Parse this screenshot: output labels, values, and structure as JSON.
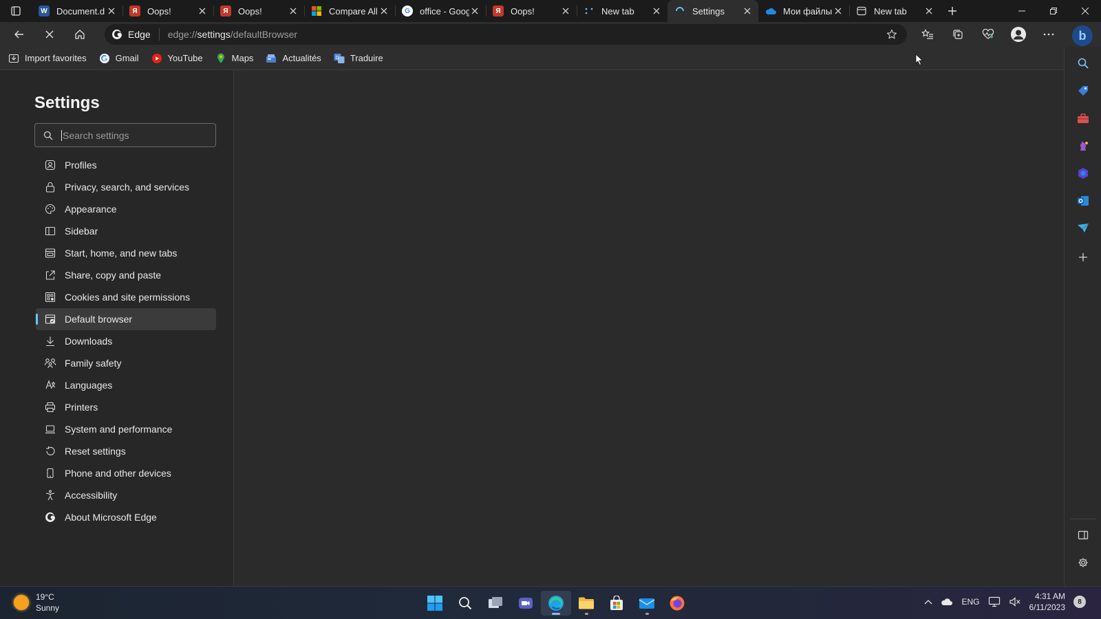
{
  "tabs": [
    {
      "title": "Document.d",
      "favicon": "word-icon",
      "color": "#2b579a",
      "letter": "W",
      "active": false
    },
    {
      "title": "Oops!",
      "favicon": "yandex-icon",
      "color": "#3a3a3a",
      "letter": "Я",
      "active": false
    },
    {
      "title": "Oops!",
      "favicon": "yandex-icon",
      "color": "#3a3a3a",
      "letter": "Я",
      "active": false
    },
    {
      "title": "Compare All",
      "favicon": "microsoft-icon",
      "color": "#f25022",
      "letter": "",
      "active": false
    },
    {
      "title": "office - Goog",
      "favicon": "google-icon",
      "color": "#ffffff",
      "letter": "G",
      "active": false
    },
    {
      "title": "Oops!",
      "favicon": "yandex-icon",
      "color": "#3a3a3a",
      "letter": "Я",
      "active": false
    },
    {
      "title": "New tab",
      "favicon": "loading-dots-icon",
      "color": "#1b1b1b",
      "letter": "",
      "active": false
    },
    {
      "title": "Settings",
      "favicon": "loading-spinner-icon",
      "color": "#2e2e2e",
      "letter": "",
      "active": true
    },
    {
      "title": "Мои файлы",
      "favicon": "onedrive-icon",
      "color": "#0f6cbd",
      "letter": "",
      "active": false
    },
    {
      "title": "New tab",
      "favicon": "newtab-page-icon",
      "color": "#1b1b1b",
      "letter": "",
      "active": false
    }
  ],
  "address": {
    "identity": "Edge",
    "scheme": "edge://",
    "host": "settings",
    "path": "/defaultBrowser"
  },
  "favorites": [
    {
      "label": "Import favorites",
      "icon": "import-favorites-icon"
    },
    {
      "label": "Gmail",
      "icon": "google-icon"
    },
    {
      "label": "YouTube",
      "icon": "youtube-icon"
    },
    {
      "label": "Maps",
      "icon": "maps-pin-icon"
    },
    {
      "label": "Actualités",
      "icon": "news-icon"
    },
    {
      "label": "Traduire",
      "icon": "translate-icon"
    }
  ],
  "settings": {
    "title": "Settings",
    "search_placeholder": "Search settings",
    "nav": [
      {
        "label": "Profiles",
        "icon": "profile-icon"
      },
      {
        "label": "Privacy, search, and services",
        "icon": "lock-icon"
      },
      {
        "label": "Appearance",
        "icon": "palette-icon"
      },
      {
        "label": "Sidebar",
        "icon": "sidebar-icon"
      },
      {
        "label": "Start, home, and new tabs",
        "icon": "home-tabs-icon"
      },
      {
        "label": "Share, copy and paste",
        "icon": "share-icon"
      },
      {
        "label": "Cookies and site permissions",
        "icon": "cookies-icon"
      },
      {
        "label": "Default browser",
        "icon": "default-browser-icon",
        "selected": true
      },
      {
        "label": "Downloads",
        "icon": "download-icon"
      },
      {
        "label": "Family safety",
        "icon": "family-icon"
      },
      {
        "label": "Languages",
        "icon": "languages-icon"
      },
      {
        "label": "Printers",
        "icon": "printer-icon"
      },
      {
        "label": "System and performance",
        "icon": "laptop-icon"
      },
      {
        "label": "Reset settings",
        "icon": "reset-icon"
      },
      {
        "label": "Phone and other devices",
        "icon": "phone-icon"
      },
      {
        "label": "Accessibility",
        "icon": "accessibility-icon"
      },
      {
        "label": "About Microsoft Edge",
        "icon": "edge-icon"
      }
    ]
  },
  "taskbar": {
    "weather_temp": "19°C",
    "weather_desc": "Sunny",
    "language": "ENG",
    "time": "4:31 AM",
    "date": "6/11/2023",
    "notifications": "8"
  },
  "colors": {
    "accent": "#60cdff",
    "background": "#202020"
  }
}
